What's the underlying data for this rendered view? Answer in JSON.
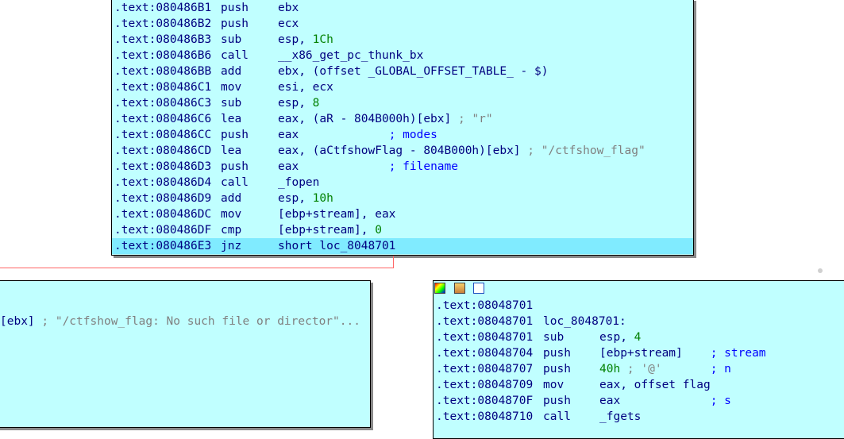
{
  "node_top": {
    "lines": [
      {
        "addr": ".text:080486B1",
        "mnem": "push",
        "ops": [
          {
            "t": "ebx",
            "c": "op"
          }
        ]
      },
      {
        "addr": ".text:080486B2",
        "mnem": "push",
        "ops": [
          {
            "t": "ecx",
            "c": "op"
          }
        ]
      },
      {
        "addr": ".text:080486B3",
        "mnem": "sub",
        "ops": [
          {
            "t": "esp, ",
            "c": "op"
          },
          {
            "t": "1Ch",
            "c": "num"
          }
        ]
      },
      {
        "addr": ".text:080486B6",
        "mnem": "call",
        "ops": [
          {
            "t": "__x86_get_pc_thunk_bx",
            "c": "name"
          }
        ]
      },
      {
        "addr": ".text:080486BB",
        "mnem": "add",
        "ops": [
          {
            "t": "ebx, (offset _GLOBAL_OFFSET_TABLE_ - $)",
            "c": "op"
          }
        ]
      },
      {
        "addr": ".text:080486C1",
        "mnem": "mov",
        "ops": [
          {
            "t": "esi, ecx",
            "c": "op"
          }
        ]
      },
      {
        "addr": ".text:080486C3",
        "mnem": "sub",
        "ops": [
          {
            "t": "esp, ",
            "c": "op"
          },
          {
            "t": "8",
            "c": "num"
          }
        ]
      },
      {
        "addr": ".text:080486C6",
        "mnem": "lea",
        "ops": [
          {
            "t": "eax, (aR - 804B000h)[ebx] ",
            "c": "op"
          },
          {
            "t": "; \"r\"",
            "c": "cmt"
          }
        ]
      },
      {
        "addr": ".text:080486CC",
        "mnem": "push",
        "ops": [
          {
            "t": "eax             ",
            "c": "op"
          },
          {
            "t": "; modes",
            "c": "cmt-blue"
          }
        ]
      },
      {
        "addr": ".text:080486CD",
        "mnem": "lea",
        "ops": [
          {
            "t": "eax, (aCtfshowFlag - 804B000h)[ebx] ",
            "c": "op"
          },
          {
            "t": "; \"/ctfshow_flag\"",
            "c": "cmt"
          }
        ]
      },
      {
        "addr": ".text:080486D3",
        "mnem": "push",
        "ops": [
          {
            "t": "eax             ",
            "c": "op"
          },
          {
            "t": "; filename",
            "c": "cmt-blue"
          }
        ]
      },
      {
        "addr": ".text:080486D4",
        "mnem": "call",
        "ops": [
          {
            "t": "_fopen",
            "c": "name"
          }
        ]
      },
      {
        "addr": ".text:080486D9",
        "mnem": "add",
        "ops": [
          {
            "t": "esp, ",
            "c": "op"
          },
          {
            "t": "10h",
            "c": "num"
          }
        ]
      },
      {
        "addr": ".text:080486DC",
        "mnem": "mov",
        "ops": [
          {
            "t": "[ebp+stream], eax",
            "c": "op"
          }
        ]
      },
      {
        "addr": ".text:080486DF",
        "mnem": "cmp",
        "ops": [
          {
            "t": "[ebp+stream], ",
            "c": "op"
          },
          {
            "t": "0",
            "c": "num"
          }
        ]
      },
      {
        "addr": ".text:080486E3",
        "mnem": "jnz",
        "ops": [
          {
            "t": "short loc_8048701",
            "c": "op"
          }
        ],
        "selected": true
      }
    ]
  },
  "node_left": {
    "lines": [
      {
        "text": "[ebx] ",
        "comment": "; \"/ctfshow_flag: No such file or director\"..."
      }
    ]
  },
  "node_right": {
    "icons": [
      "color-icon",
      "edit-icon",
      "graph-icon"
    ],
    "lines": [
      {
        "addr": ".text:08048701",
        "mnem": "",
        "ops": []
      },
      {
        "addr": ".text:08048701",
        "mnem": "loc_8048701:",
        "ops": []
      },
      {
        "addr": ".text:08048701",
        "mnem": "sub",
        "ops": [
          {
            "t": "esp, ",
            "c": "op"
          },
          {
            "t": "4",
            "c": "num"
          }
        ]
      },
      {
        "addr": ".text:08048704",
        "mnem": "push",
        "ops": [
          {
            "t": "[ebp+stream]    ",
            "c": "op"
          },
          {
            "t": "; stream",
            "c": "cmt-blue"
          }
        ]
      },
      {
        "addr": ".text:08048707",
        "mnem": "push",
        "ops": [
          {
            "t": "40h",
            "c": "num"
          },
          {
            "t": " ; '@'       ",
            "c": "cmt"
          },
          {
            "t": "; n",
            "c": "cmt-blue"
          }
        ]
      },
      {
        "addr": ".text:08048709",
        "mnem": "mov",
        "ops": [
          {
            "t": "eax, offset flag",
            "c": "op"
          }
        ]
      },
      {
        "addr": ".text:0804870F",
        "mnem": "push",
        "ops": [
          {
            "t": "eax             ",
            "c": "op"
          },
          {
            "t": "; s",
            "c": "cmt-blue"
          }
        ]
      },
      {
        "addr": ".text:08048710",
        "mnem": "call",
        "ops": [
          {
            "t": "_fgets",
            "c": "name"
          }
        ]
      }
    ]
  },
  "colors": {
    "node_bg": "#c0ffff",
    "selected_bg": "#80ebff",
    "text": "#000080",
    "number": "#008000",
    "comment": "#808080",
    "edge_red": "#ff6666"
  }
}
